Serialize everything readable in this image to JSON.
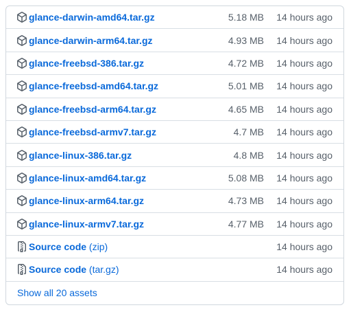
{
  "assets": [
    {
      "name": "glance-darwin-amd64.tar.gz",
      "size": "5.18 MB",
      "time": "14 hours ago",
      "icon": "package-icon"
    },
    {
      "name": "glance-darwin-arm64.tar.gz",
      "size": "4.93 MB",
      "time": "14 hours ago",
      "icon": "package-icon"
    },
    {
      "name": "glance-freebsd-386.tar.gz",
      "size": "4.72 MB",
      "time": "14 hours ago",
      "icon": "package-icon"
    },
    {
      "name": "glance-freebsd-amd64.tar.gz",
      "size": "5.01 MB",
      "time": "14 hours ago",
      "icon": "package-icon"
    },
    {
      "name": "glance-freebsd-arm64.tar.gz",
      "size": "4.65 MB",
      "time": "14 hours ago",
      "icon": "package-icon"
    },
    {
      "name": "glance-freebsd-armv7.tar.gz",
      "size": "4.7 MB",
      "time": "14 hours ago",
      "icon": "package-icon"
    },
    {
      "name": "glance-linux-386.tar.gz",
      "size": "4.8 MB",
      "time": "14 hours ago",
      "icon": "package-icon"
    },
    {
      "name": "glance-linux-amd64.tar.gz",
      "size": "5.08 MB",
      "time": "14 hours ago",
      "icon": "package-icon"
    },
    {
      "name": "glance-linux-arm64.tar.gz",
      "size": "4.73 MB",
      "time": "14 hours ago",
      "icon": "package-icon"
    },
    {
      "name": "glance-linux-armv7.tar.gz",
      "size": "4.77 MB",
      "time": "14 hours ago",
      "icon": "package-icon"
    }
  ],
  "source": [
    {
      "name": "Source code",
      "format": "(zip)",
      "time": "14 hours ago",
      "icon": "file-zip-icon"
    },
    {
      "name": "Source code",
      "format": "(tar.gz)",
      "time": "14 hours ago",
      "icon": "file-zip-icon"
    }
  ],
  "show_all": "Show all 20 assets",
  "colors": {
    "link": "#0969da",
    "muted": "#57606a",
    "border": "#d0d7de"
  }
}
